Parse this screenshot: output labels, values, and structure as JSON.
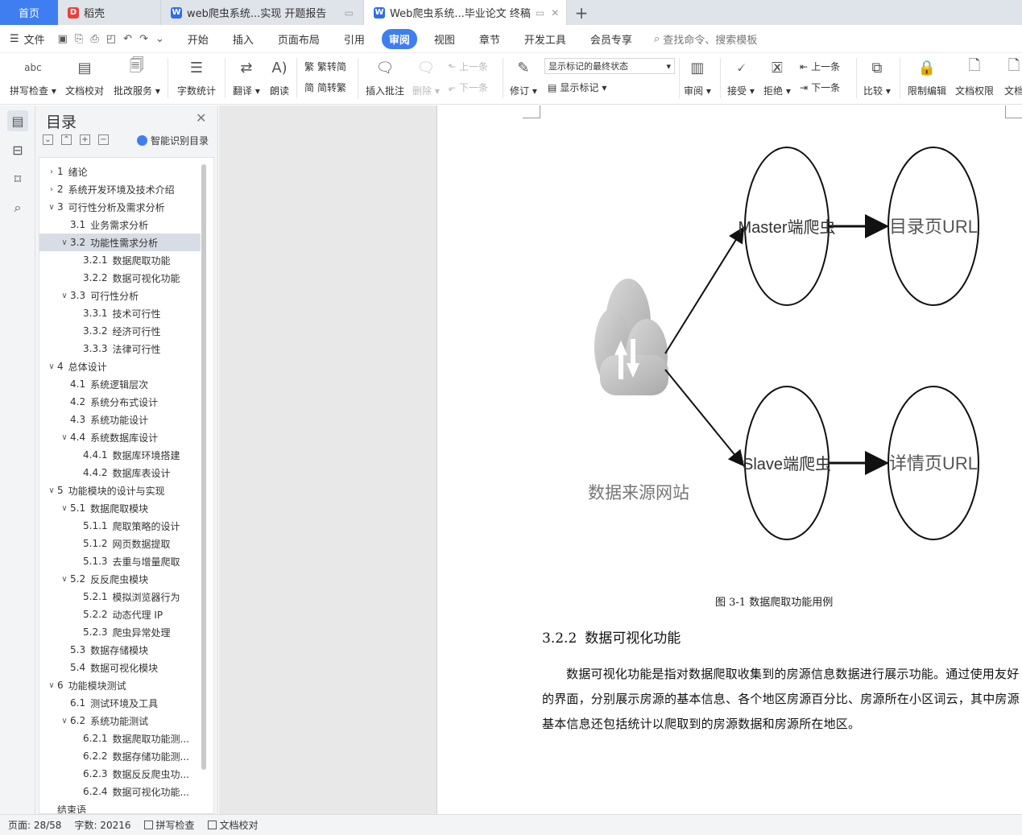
{
  "tabs": [
    {
      "label": "首页",
      "logo": ""
    },
    {
      "label": "稻壳",
      "logo": "D"
    },
    {
      "label": "web爬虫系统...实现 开题报告",
      "logo": "W"
    },
    {
      "label": "Web爬虫系统...毕业论文 终稿",
      "logo": "W"
    }
  ],
  "menu": {
    "file": "文件",
    "items": [
      "开始",
      "插入",
      "页面布局",
      "引用",
      "审阅",
      "视图",
      "章节",
      "开发工具",
      "会员专享"
    ],
    "active": "审阅",
    "search": "查找命令、搜索模板"
  },
  "ribbon": {
    "spell_icon": "abc",
    "spell": "拼写检查",
    "proof": "文档校对",
    "batch": "批改服务",
    "wordcount": "字数统计",
    "translate": "翻译",
    "read": "朗读",
    "s2t": "繁转简",
    "t2s": "简转繁",
    "insert_comment": "插入批注",
    "delete": "删除",
    "prev": "上一条",
    "next": "下一条",
    "revise": "修订",
    "markup_state": "显示标记的最终状态",
    "show_markup": "显示标记",
    "review": "审阅",
    "accept": "接受",
    "reject": "拒绝",
    "prev2": "上一条",
    "next2": "下一条",
    "compare": "比较",
    "restrict": "限制编辑",
    "perm": "文档权限",
    "more": "文档"
  },
  "toc": {
    "title": "目录",
    "smart": "智能识别目录",
    "items": [
      {
        "n": "1",
        "t": "绪论",
        "lvl": 1,
        "chev": "right"
      },
      {
        "n": "2",
        "t": "系统开发环境及技术介绍",
        "lvl": 1,
        "chev": "right"
      },
      {
        "n": "3",
        "t": "可行性分析及需求分析",
        "lvl": 1,
        "chev": "down"
      },
      {
        "n": "3.1",
        "t": "业务需求分析",
        "lvl": 2,
        "chev": ""
      },
      {
        "n": "3.2",
        "t": "功能性需求分析",
        "lvl": 2,
        "chev": "down",
        "sel": true
      },
      {
        "n": "3.2.1",
        "t": "数据爬取功能",
        "lvl": 3,
        "chev": ""
      },
      {
        "n": "3.2.2",
        "t": "数据可视化功能",
        "lvl": 3,
        "chev": ""
      },
      {
        "n": "3.3",
        "t": "可行性分析",
        "lvl": 2,
        "chev": "down"
      },
      {
        "n": "3.3.1",
        "t": "技术可行性",
        "lvl": 3,
        "chev": ""
      },
      {
        "n": "3.3.2",
        "t": "经济可行性",
        "lvl": 3,
        "chev": ""
      },
      {
        "n": "3.3.3",
        "t": "法律可行性",
        "lvl": 3,
        "chev": ""
      },
      {
        "n": "4",
        "t": "总体设计",
        "lvl": 1,
        "chev": "down"
      },
      {
        "n": "4.1",
        "t": "系统逻辑层次",
        "lvl": 2,
        "chev": ""
      },
      {
        "n": "4.2",
        "t": "系统分布式设计",
        "lvl": 2,
        "chev": ""
      },
      {
        "n": "4.3",
        "t": "系统功能设计",
        "lvl": 2,
        "chev": ""
      },
      {
        "n": "4.4",
        "t": "系统数据库设计",
        "lvl": 2,
        "chev": "down"
      },
      {
        "n": "4.4.1",
        "t": "数据库环境搭建",
        "lvl": 3,
        "chev": ""
      },
      {
        "n": "4.4.2",
        "t": "数据库表设计",
        "lvl": 3,
        "chev": ""
      },
      {
        "n": "5",
        "t": "功能模块的设计与实现",
        "lvl": 1,
        "chev": "down"
      },
      {
        "n": "5.1",
        "t": "数据爬取模块",
        "lvl": 2,
        "chev": "down"
      },
      {
        "n": "5.1.1",
        "t": "爬取策略的设计",
        "lvl": 3,
        "chev": ""
      },
      {
        "n": "5.1.2",
        "t": "网页数据提取",
        "lvl": 3,
        "chev": ""
      },
      {
        "n": "5.1.3",
        "t": "去重与增量爬取",
        "lvl": 3,
        "chev": ""
      },
      {
        "n": "5.2",
        "t": "反反爬虫模块",
        "lvl": 2,
        "chev": "down"
      },
      {
        "n": "5.2.1",
        "t": "模拟浏览器行为",
        "lvl": 3,
        "chev": ""
      },
      {
        "n": "5.2.2",
        "t": "动态代理 IP",
        "lvl": 3,
        "chev": ""
      },
      {
        "n": "5.2.3",
        "t": "爬虫异常处理",
        "lvl": 3,
        "chev": ""
      },
      {
        "n": "5.3",
        "t": "数据存储模块",
        "lvl": 2,
        "chev": ""
      },
      {
        "n": "5.4",
        "t": "数据可视化模块",
        "lvl": 2,
        "chev": ""
      },
      {
        "n": "6",
        "t": "功能模块测试",
        "lvl": 1,
        "chev": "down"
      },
      {
        "n": "6.1",
        "t": "测试环境及工具",
        "lvl": 2,
        "chev": ""
      },
      {
        "n": "6.2",
        "t": "系统功能测试",
        "lvl": 2,
        "chev": "down"
      },
      {
        "n": "6.2.1",
        "t": "数据爬取功能测...",
        "lvl": 3,
        "chev": ""
      },
      {
        "n": "6.2.2",
        "t": "数据存储功能测...",
        "lvl": 3,
        "chev": ""
      },
      {
        "n": "6.2.3",
        "t": "数据反反爬虫功...",
        "lvl": 3,
        "chev": ""
      },
      {
        "n": "6.2.4",
        "t": "数据可视化功能...",
        "lvl": 3,
        "chev": ""
      },
      {
        "n": "",
        "t": "结束语",
        "lvl": 1,
        "chev": ""
      }
    ]
  },
  "doc": {
    "diagram": {
      "source": "数据来源网站",
      "master": "Master端爬虫",
      "slave": "Slave端爬虫",
      "list_url": "目录页URL",
      "detail_url": "详情页URL"
    },
    "caption": "图 3-1 数据爬取功能用例",
    "heading_num": "3.2.2",
    "heading_text": "数据可视化功能",
    "paragraph": "数据可视化功能是指对数据爬取收集到的房源信息数据进行展示功能。通过使用友好的界面，分别展示房源的基本信息、各个地区房源百分比、房源所在小区词云，其中房源基本信息还包括统计以爬取到的房源数据和房源所在地区。"
  },
  "status": {
    "page": "页面: 28/58",
    "words": "字数: 20216",
    "spell": "拼写检查",
    "proof": "文档校对"
  },
  "colors": {
    "accent": "#3f7ef0",
    "tabbar": "#dfe3ea"
  }
}
